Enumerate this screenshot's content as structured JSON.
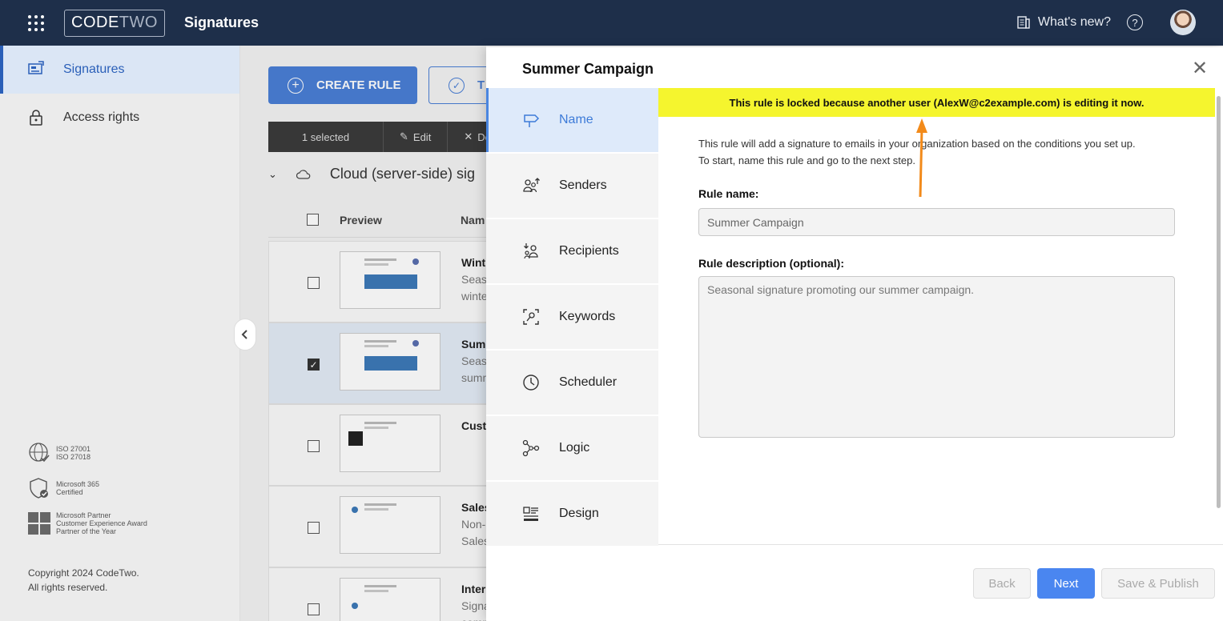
{
  "topbar": {
    "logo_code": "CODE",
    "logo_two": "TWO",
    "app_title": "Signatures",
    "whats_new": "What's new?",
    "help_glyph": "?"
  },
  "sidebar": {
    "items": [
      {
        "label": "Signatures",
        "icon": "signatures-icon"
      },
      {
        "label": "Access rights",
        "icon": "lock-icon"
      }
    ],
    "badges": [
      {
        "line1": "ISO 27001",
        "line2": "ISO 27018"
      },
      {
        "line1": "Microsoft 365",
        "line2": "Certified"
      },
      {
        "line1": "Microsoft Partner",
        "line2": "Customer Experience Award",
        "line3": "Partner of the Year"
      }
    ],
    "copyright_line1": "Copyright 2024 CodeTwo.",
    "copyright_line2": "All rights reserved."
  },
  "main": {
    "create_rule": "CREATE RULE",
    "test_label": "T",
    "toolbar": {
      "selected": "1 selected",
      "edit": "Edit",
      "delete": "De"
    },
    "group_title": "Cloud (server-side) sig",
    "columns": {
      "preview": "Preview",
      "name": "Nam"
    },
    "rows": [
      {
        "title": "Wint",
        "line1": "Seaso",
        "line2": "winte",
        "checked": false
      },
      {
        "title": "Sumr",
        "line1": "Seaso",
        "line2": "summ",
        "checked": true
      },
      {
        "title": "Custo",
        "line1": "",
        "line2": "",
        "checked": false
      },
      {
        "title": "Sales",
        "line1": "Non-",
        "line2": "Sales",
        "checked": false
      },
      {
        "title": "Inter",
        "line1": "Signa",
        "line2": "comp",
        "checked": false
      }
    ]
  },
  "panel": {
    "title": "Summer Campaign",
    "close_glyph": "✕",
    "steps": [
      {
        "label": "Name",
        "icon": "signpost-icon",
        "active": true
      },
      {
        "label": "Senders",
        "icon": "senders-icon",
        "active": false
      },
      {
        "label": "Recipients",
        "icon": "recipients-icon",
        "active": false
      },
      {
        "label": "Keywords",
        "icon": "keywords-icon",
        "active": false
      },
      {
        "label": "Scheduler",
        "icon": "clock-icon",
        "active": false
      },
      {
        "label": "Logic",
        "icon": "logic-icon",
        "active": false
      },
      {
        "label": "Design",
        "icon": "design-icon",
        "active": false
      }
    ],
    "locked_banner": "This rule is locked because another user (AlexW@c2example.com) is editing it now.",
    "intro_line1": "This rule will add a signature to emails in your organization based on the conditions you set up.",
    "intro_line2": "To start, name this rule and go to the next step.",
    "rule_name_label": "Rule name:",
    "rule_name_value": "Summer Campaign",
    "rule_desc_label": "Rule description (optional):",
    "rule_desc_value": "Seasonal signature promoting our summer campaign.",
    "buttons": {
      "back": "Back",
      "next": "Next",
      "save_publish": "Save & Publish"
    }
  },
  "colors": {
    "topbar": "#1e2f4a",
    "accent": "#4a86f0",
    "banner": "#f5f52e",
    "arrow": "#f28a1a"
  }
}
